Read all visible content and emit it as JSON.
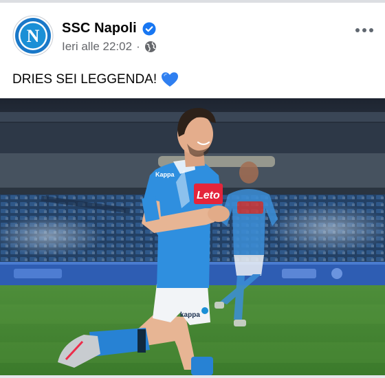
{
  "post": {
    "author": "SSC Napoli",
    "timestamp": "Ieri alle 22:02",
    "separator": "·",
    "privacy_icon": "globe-icon",
    "verified_icon": "verified-badge-icon",
    "more_icon": "more-options-icon",
    "caption": "DRIES SEI LEGGENDA!",
    "caption_emoji": "blue-heart-icon",
    "logo_letter": "N",
    "shirt_sponsor": "Leto",
    "colors": {
      "napoli_blue": "#1a8fd6",
      "verified_blue": "#1877f2",
      "meta_gray": "#65676b",
      "heart_blue": "#2f7ff0"
    }
  }
}
